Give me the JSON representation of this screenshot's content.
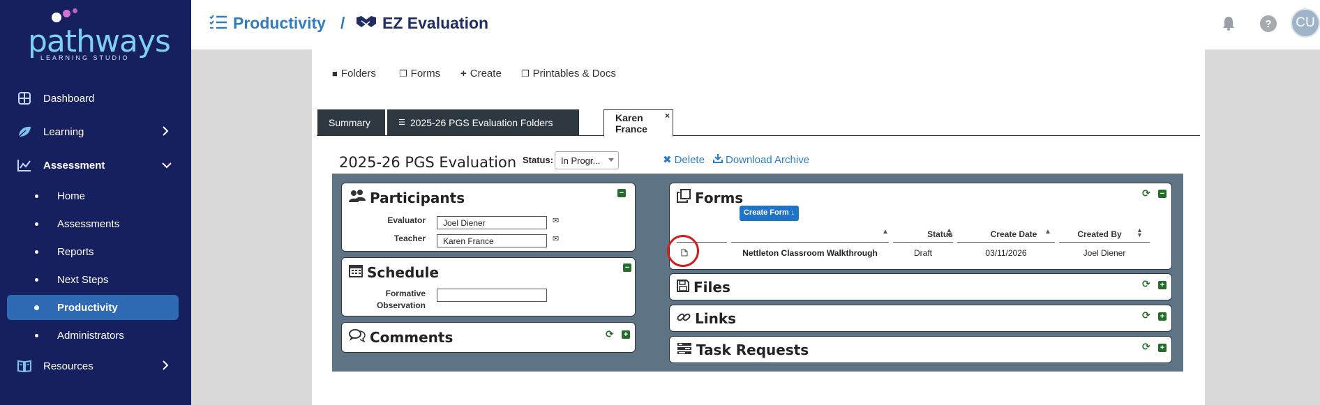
{
  "sidebar": {
    "logo": {
      "word": "pathways",
      "sub": "LEARNING STUDIO"
    },
    "items": [
      {
        "label": "Dashboard",
        "icon": "grid-icon"
      },
      {
        "label": "Learning",
        "icon": "leaf-icon"
      },
      {
        "label": "Assessment",
        "icon": "chart-icon"
      },
      {
        "label": "Resources",
        "icon": "book-icon"
      }
    ],
    "assessment_sub": [
      {
        "label": "Home"
      },
      {
        "label": "Assessments"
      },
      {
        "label": "Reports"
      },
      {
        "label": "Next Steps"
      },
      {
        "label": "Productivity"
      },
      {
        "label": "Administrators"
      }
    ]
  },
  "header": {
    "crumb1": "Productivity",
    "sep": "/",
    "crumb2": "EZ Evaluation",
    "avatar": "CU",
    "help": "?"
  },
  "toolbar": {
    "folders": "Folders",
    "forms": "Forms",
    "create": "Create",
    "printables": "Printables & Docs"
  },
  "tabs": {
    "summary": "Summary",
    "folders": "2025-26 PGS Evaluation Folders",
    "karen": "Karen France",
    "close": "×"
  },
  "evaluation": {
    "title": "2025-26 PGS Evaluation",
    "status_label": "Status:",
    "status_value": "In Progr...",
    "delete": "Delete",
    "download": "Download Archive"
  },
  "participants": {
    "title": "Participants",
    "evaluator_label": "Evaluator",
    "evaluator_value": "Joel Diener",
    "teacher_label": "Teacher",
    "teacher_value": "Karen France"
  },
  "schedule": {
    "title": "Schedule",
    "formative_label_1": "Formative",
    "formative_label_2": "Observation",
    "formative_value": ""
  },
  "comments": {
    "title": "Comments"
  },
  "forms": {
    "title": "Forms",
    "create_btn": "Create Form ↓",
    "columns": [
      "Status",
      "Create Date",
      "Created By"
    ],
    "rows": [
      {
        "name": "Nettleton Classroom Walkthrough",
        "status": "Draft",
        "date": "03/11/2026",
        "by": "Joel Diener"
      }
    ]
  },
  "files": {
    "title": "Files"
  },
  "links": {
    "title": "Links"
  },
  "tasks": {
    "title": "Task Requests"
  },
  "colors": {
    "sidebar": "#17205e",
    "active": "#2f6bb5",
    "accent": "#2d7cc4",
    "board": "#5e7485",
    "green": "#256b2c",
    "highlight": "#d41c1c"
  }
}
